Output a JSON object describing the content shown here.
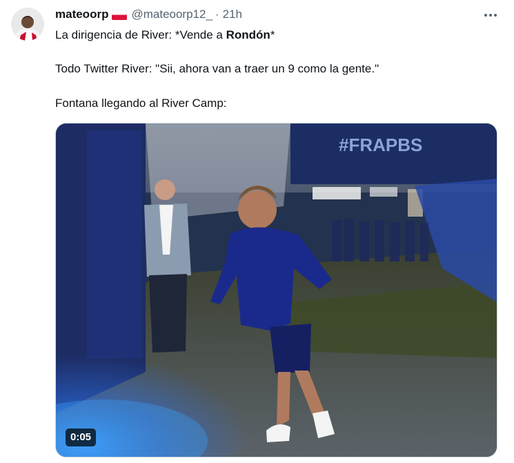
{
  "tweet": {
    "display_name": "mateoorp",
    "handle": "@mateoorp12_",
    "separator": "·",
    "time": "21h",
    "more_icon": "ellipsis-icon",
    "flag_icon": "poland-flag-icon",
    "line1": {
      "prefix": "La dirigencia de River: *Vende a ",
      "bold": "Rondón",
      "suffix": "*"
    },
    "line2": "Todo Twitter River: \"Sii, ahora van a traer un 9 como la gente.\"",
    "line3": "Fontana llegando al River Camp:",
    "media": {
      "banner_text": "#FRAPBS",
      "duration": "0:05"
    }
  }
}
